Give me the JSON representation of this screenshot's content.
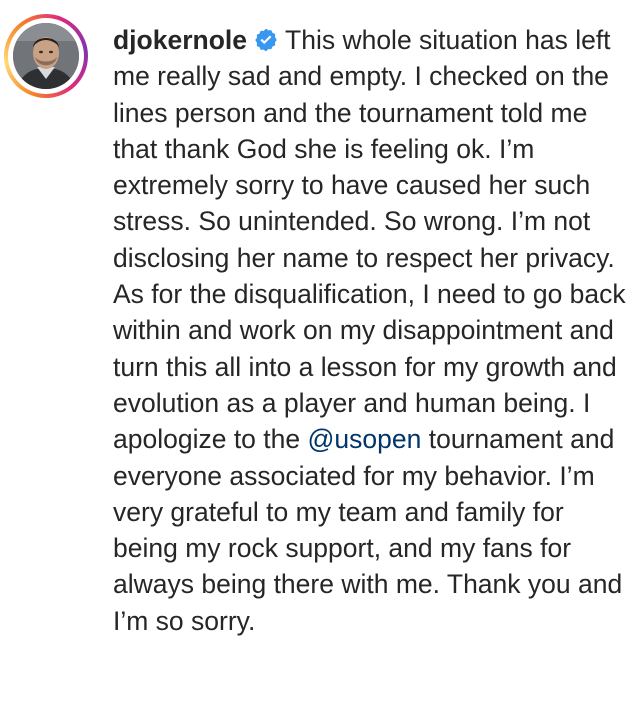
{
  "post": {
    "username": "djokernole",
    "verified_icon": "verified-badge-icon",
    "caption_part1": "This whole situation has left me really sad and empty. I checked on the lines person and the tournament told me that thank God she is feeling ok. I’m extremely sorry to have caused her such stress. So unintended. So wrong. I’m not disclosing her name to respect her privacy. As for the disqualification, I need to go back within and work on my disappointment and turn this all into a lesson for my growth and evolution as a player and human being. I apologize to the",
    "mention": "@usopen",
    "caption_part2": "tournament and everyone associated for my behavior. I’m very grateful to my team and family for being my rock support, and my fans for always being there with me. Thank you and I’m so sorry."
  },
  "colors": {
    "text": "#262626",
    "mention": "#003569",
    "verified": "#3897f0"
  }
}
